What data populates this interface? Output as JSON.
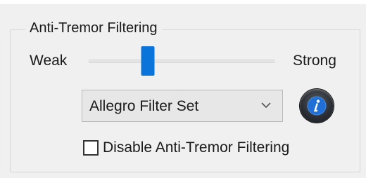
{
  "group": {
    "title": "Anti-Tremor Filtering"
  },
  "slider": {
    "min_label": "Weak",
    "max_label": "Strong",
    "value": 0.32
  },
  "filter_select": {
    "selected": "Allegro Filter Set"
  },
  "info_button": {
    "icon": "info-icon"
  },
  "disable_checkbox": {
    "label": "Disable Anti-Tremor Filtering",
    "checked": false
  },
  "colors": {
    "accent": "#0a74da",
    "background": "#f0f0f0"
  }
}
